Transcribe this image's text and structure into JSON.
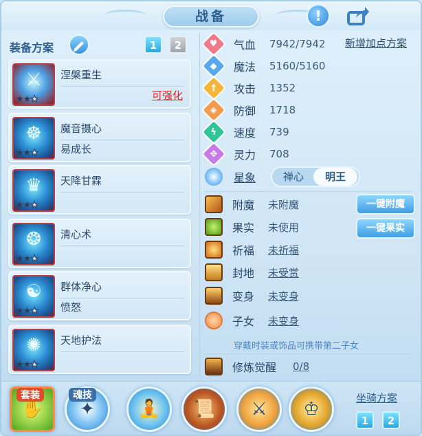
{
  "title": "战备",
  "left": {
    "scheme_label": "装备方案",
    "scheme_buttons": [
      "1",
      "2"
    ],
    "skills": [
      {
        "name": "涅槃重生",
        "sub": "",
        "action": "可强化",
        "stars": "★★☆",
        "icon": "phoenix-spear-icon"
      },
      {
        "name": "魔音摄心",
        "sub": "易成长",
        "action": "",
        "stars": "★★☆",
        "icon": "blue-mask-icon"
      },
      {
        "name": "天降甘霖",
        "sub": "",
        "action": "",
        "stars": "★★☆",
        "icon": "rain-deity-icon"
      },
      {
        "name": "清心术",
        "sub": "",
        "action": "",
        "stars": "★★☆",
        "icon": "calm-heart-icon"
      },
      {
        "name": "群体净心",
        "sub": "愤怒",
        "action": "",
        "stars": "★★☆",
        "icon": "group-purify-icon"
      },
      {
        "name": "天地护法",
        "sub": "",
        "action": "",
        "stars": "★★☆",
        "icon": "guardian-icon"
      }
    ]
  },
  "right": {
    "stats": [
      {
        "label": "气血",
        "value": "7942/7942",
        "icon": "heart-icon",
        "color": "#f07a8a"
      },
      {
        "label": "魔法",
        "value": "5160/5160",
        "icon": "mana-icon",
        "color": "#56a9ee"
      },
      {
        "label": "攻击",
        "value": "1352",
        "icon": "sword-icon",
        "color": "#f5b53a"
      },
      {
        "label": "防御",
        "value": "1718",
        "icon": "shield-icon",
        "color": "#f39a4e"
      },
      {
        "label": "速度",
        "value": "739",
        "icon": "lightning-icon",
        "color": "#33c59a"
      },
      {
        "label": "灵力",
        "value": "708",
        "icon": "spirit-icon",
        "color": "#c87ae8"
      }
    ],
    "add_points_link": "新增加点方案",
    "constellation_label": "星象",
    "constellation_options": [
      "禅心",
      "明王"
    ],
    "buffs": [
      {
        "label": "附魔",
        "value": "未附魔",
        "icon": "enchant-icon"
      },
      {
        "label": "果实",
        "value": "未使用",
        "icon": "fruit-icon"
      },
      {
        "label": "祈福",
        "value": "未祈福",
        "icon": "bless-icon"
      },
      {
        "label": "封地",
        "value": "未受赏",
        "icon": "fief-icon"
      },
      {
        "label": "变身",
        "value": "未变身",
        "icon": "transform-icon"
      },
      {
        "label": "子女",
        "value": "未变身",
        "icon": "child-icon"
      }
    ],
    "one_click_enchant": "一键附魔",
    "one_click_fruit": "一键果实",
    "hint": "穿戴时装或饰品可携带第二子女",
    "cultivation_label": "修炼觉醒",
    "cultivation_value": "0/8"
  },
  "bottom": {
    "tag_outfit": "套装",
    "tag_soul": "魂技",
    "mount_label": "坐骑方案",
    "mount_buttons": [
      "1",
      "2"
    ]
  }
}
